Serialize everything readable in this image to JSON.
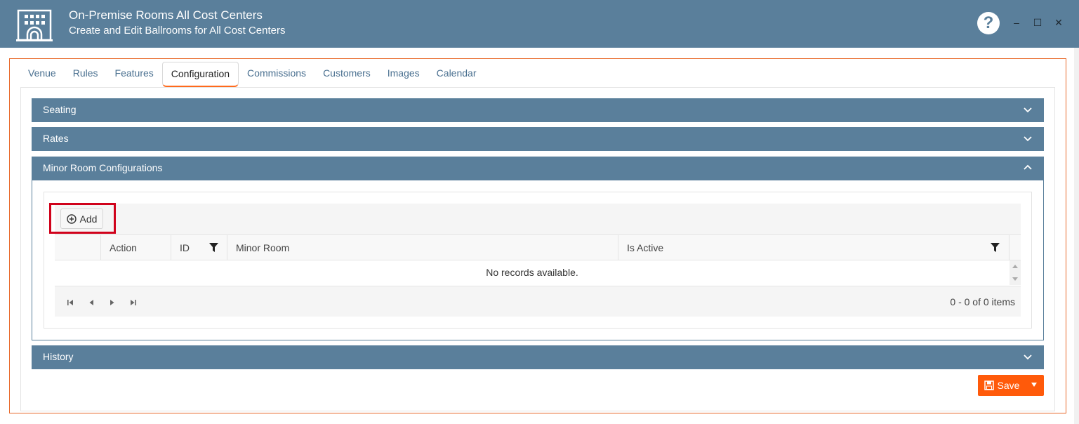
{
  "window": {
    "title": "On-Premise Rooms All Cost Centers",
    "subtitle": "Create and Edit Ballrooms for All Cost Centers",
    "help_label": "?",
    "minimize_label": "–",
    "maximize_label": "☐",
    "close_label": "✕"
  },
  "tabs": [
    {
      "label": "Venue"
    },
    {
      "label": "Rules"
    },
    {
      "label": "Features"
    },
    {
      "label": "Configuration",
      "active": true
    },
    {
      "label": "Commissions"
    },
    {
      "label": "Customers"
    },
    {
      "label": "Images"
    },
    {
      "label": "Calendar"
    }
  ],
  "panels": {
    "seating": "Seating",
    "rates": "Rates",
    "minor": "Minor Room Configurations",
    "history": "History"
  },
  "grid": {
    "add_label": "Add",
    "columns": [
      "Action",
      "ID",
      "Minor Room",
      "Is Active"
    ],
    "empty_message": "No records available.",
    "pager_info": "0 - 0 of 0 items"
  },
  "save": {
    "label": "Save"
  },
  "colors": {
    "header": "#5a7f9b",
    "accent": "#ff5a0a",
    "highlight": "#d0021b"
  }
}
